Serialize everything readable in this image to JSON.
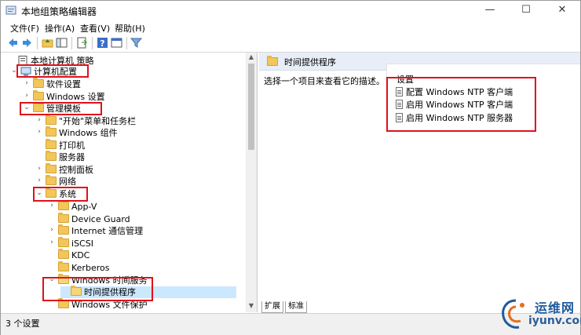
{
  "window": {
    "title": "本地组策略编辑器",
    "minimize": "—",
    "maximize": "☐",
    "close": "✕"
  },
  "menu": [
    "文件(F)",
    "操作(A)",
    "查看(V)",
    "帮助(H)"
  ],
  "toolbar": [
    "back-icon",
    "forward-icon",
    "up-folder-icon",
    "show-hide-tree-icon",
    "export-list-icon",
    "help-icon",
    "properties-icon",
    "filter-icon"
  ],
  "tree": [
    {
      "label": "本地计算机 策略",
      "expander": "",
      "icon": "policy"
    },
    {
      "label": "计算机配置",
      "expander": "v",
      "icon": "computer"
    },
    {
      "label": "软件设置",
      "expander": ">",
      "icon": "folder"
    },
    {
      "label": "Windows 设置",
      "expander": ">",
      "icon": "folder"
    },
    {
      "label": "管理模板",
      "expander": "v",
      "icon": "folder"
    },
    {
      "label": "\"开始\"菜单和任务栏",
      "expander": ">",
      "icon": "folder"
    },
    {
      "label": "Windows 组件",
      "expander": ">",
      "icon": "folder"
    },
    {
      "label": "打印机",
      "expander": "",
      "icon": "folder"
    },
    {
      "label": "服务器",
      "expander": "",
      "icon": "folder"
    },
    {
      "label": "控制面板",
      "expander": ">",
      "icon": "folder"
    },
    {
      "label": "网络",
      "expander": ">",
      "icon": "folder"
    },
    {
      "label": "系统",
      "expander": "v",
      "icon": "folder"
    },
    {
      "label": "App-V",
      "expander": ">",
      "icon": "folder"
    },
    {
      "label": "Device Guard",
      "expander": "",
      "icon": "folder"
    },
    {
      "label": "Internet 通信管理",
      "expander": ">",
      "icon": "folder"
    },
    {
      "label": "iSCSI",
      "expander": ">",
      "icon": "folder"
    },
    {
      "label": "KDC",
      "expander": "",
      "icon": "folder"
    },
    {
      "label": "Kerberos",
      "expander": "",
      "icon": "folder"
    },
    {
      "label": "Windows 时间服务",
      "expander": "v",
      "icon": "folder-open"
    },
    {
      "label": "时间提供程序",
      "expander": "",
      "icon": "folder-open"
    },
    {
      "label": "Windows 文件保护",
      "expander": "",
      "icon": "folder"
    }
  ],
  "right": {
    "header": "时间提供程序",
    "description": "选择一个项目来查看它的描述。",
    "column": "设置",
    "settings": [
      "配置 Windows NTP 客户端",
      "启用 Windows NTP 客户端",
      "启用 Windows NTP 服务器"
    ]
  },
  "tabs": [
    "扩展",
    "标准"
  ],
  "status": "3 个设置",
  "watermark": {
    "line1": "运维网",
    "line2": "iyunv.com"
  },
  "colors": {
    "highlight": "#e0101a",
    "selection": "#cce8ff",
    "folder": "#f2c659"
  }
}
